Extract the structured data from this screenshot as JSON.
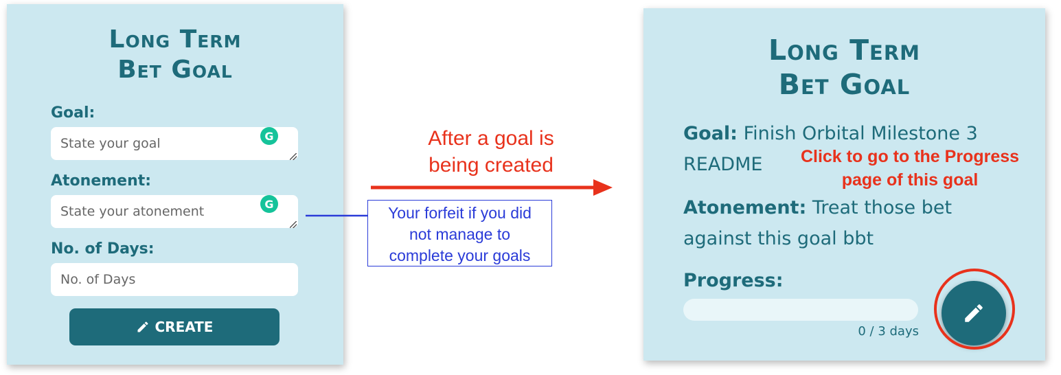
{
  "create_form": {
    "title_line1": "Long Term",
    "title_line2": "Bet Goal",
    "goal_label": "Goal:",
    "goal_placeholder": "State your goal",
    "atonement_label": "Atonement:",
    "atonement_placeholder": "State your atonement",
    "days_label": "No. of Days:",
    "days_placeholder": "No. of Days",
    "create_label": "CREATE",
    "grammarly_icon": "G"
  },
  "annotations": {
    "transition_line1": "After a goal is",
    "transition_line2": "being created",
    "forfeit_line1": "Your forfeit if you did",
    "forfeit_line2": "not manage to",
    "forfeit_line3": "complete your goals",
    "click_line1": "Click to go to the Progress",
    "click_line2": "page of this goal"
  },
  "goal_view": {
    "title_line1": "Long Term",
    "title_line2": "Bet Goal",
    "goal_label": "Goal:",
    "goal_value": "Finish Orbital Milestone 3 README",
    "atonement_label": "Atonement:",
    "atonement_value": "Treat those bet against this goal bbt",
    "progress_label": "Progress:",
    "progress_fraction": 0,
    "days_text": "0 / 3 days"
  },
  "colors": {
    "card_bg": "#cce8f0",
    "primary": "#1e6b7a",
    "annotation_red": "#e8321c",
    "annotation_blue": "#2a3bd8",
    "grammarly": "#15c39a"
  },
  "icons": {
    "create_button": "pencil-icon",
    "edit_fab": "pencil-icon",
    "field_assist": "grammarly-icon"
  }
}
